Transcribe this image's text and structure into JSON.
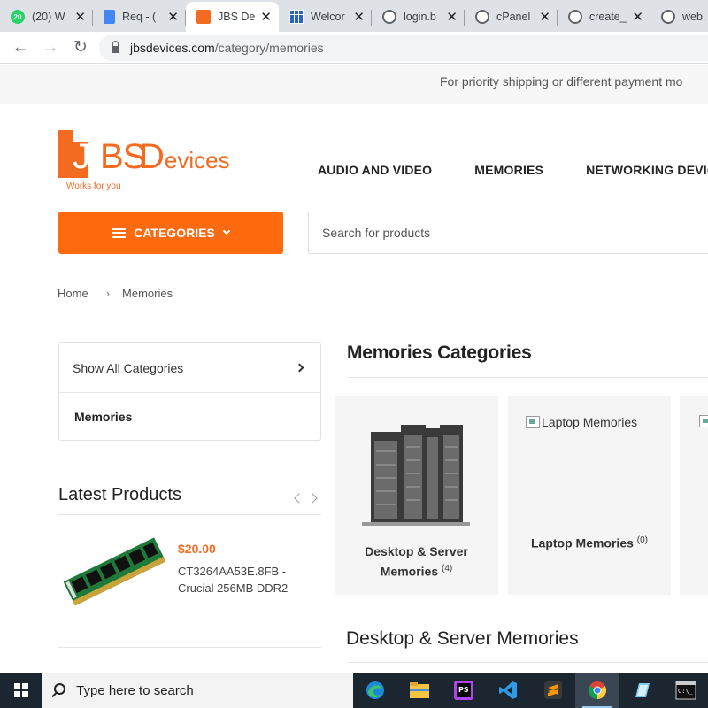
{
  "browser": {
    "tabs": [
      {
        "title": "(20) W",
        "favicon": "whatsapp-icon",
        "badge": "20"
      },
      {
        "title": "Req - (",
        "favicon": "docs-icon"
      },
      {
        "title": "JBS De",
        "favicon": "jbs-icon",
        "active": true
      },
      {
        "title": "Welcor",
        "favicon": "grid-icon"
      },
      {
        "title": "login.b",
        "favicon": "globe-icon"
      },
      {
        "title": "cPanel",
        "favicon": "globe-icon"
      },
      {
        "title": "create_",
        "favicon": "globe-icon"
      },
      {
        "title": "web.",
        "favicon": "globe-icon"
      }
    ],
    "url_domain": "jbsdevices.com",
    "url_path": "/category/memories"
  },
  "notice": "For priority shipping or different payment mo",
  "logo": {
    "j": "J",
    "bs": "BS",
    "d": "D",
    "evices": "evices",
    "tagline": "Works for you"
  },
  "nav": [
    "AUDIO AND VIDEO",
    "MEMORIES",
    "NETWORKING DEVICES"
  ],
  "categories_button": "CATEGORIES",
  "search": {
    "placeholder": "Search for products"
  },
  "breadcrumb": {
    "home": "Home",
    "separator": "›",
    "current": "Memories"
  },
  "sidebar": {
    "show_all": "Show All Categories",
    "current": "Memories"
  },
  "latest": {
    "title": "Latest Products",
    "product": {
      "price": "$20.00",
      "name": "CT3264AA53E.8FB - Crucial 256MB DDR2-"
    }
  },
  "category_section": {
    "title": "Memories Categories",
    "cards": [
      {
        "name": "Desktop & Server Memories",
        "count": "(4)"
      },
      {
        "name": "Laptop Memories",
        "count": "(0)",
        "broken_alt": "Laptop Memories"
      }
    ]
  },
  "section2_title": "Desktop & Server Memories",
  "taskbar": {
    "search_placeholder": "Type here to search"
  },
  "colors": {
    "accent": "#ff6a0f",
    "brand": "#f26b21",
    "price": "#f26b21"
  }
}
